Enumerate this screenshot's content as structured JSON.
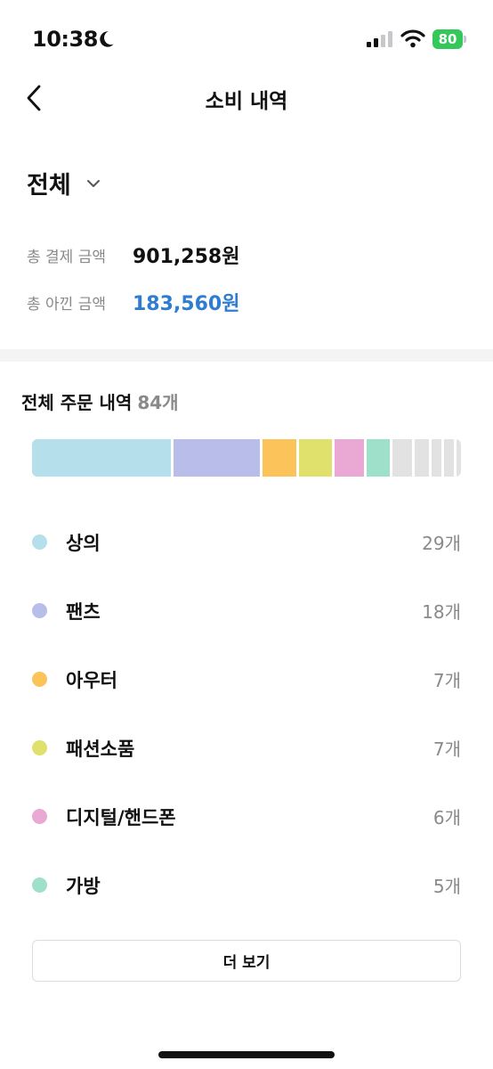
{
  "status_bar": {
    "time": "10:38",
    "battery": "80"
  },
  "header": {
    "title": "소비 내역"
  },
  "filter": {
    "label": "전체"
  },
  "summary": {
    "paid_label": "총 결제 금액",
    "paid_value": "901,258원",
    "saved_label": "총 아낀 금액",
    "saved_value": "183,560원",
    "saved_color": "#2f7dd1"
  },
  "orders": {
    "title": "전체 주문 내역",
    "count": "84개",
    "total": 84
  },
  "categories": [
    {
      "name": "상의",
      "count_label": "29개",
      "count": 29,
      "color": "#b5dfea"
    },
    {
      "name": "팬츠",
      "count_label": "18개",
      "count": 18,
      "color": "#b9bdea"
    },
    {
      "name": "아우터",
      "count_label": "7개",
      "count": 7,
      "color": "#fcc35a"
    },
    {
      "name": "패션소품",
      "count_label": "7개",
      "count": 7,
      "color": "#dfe16c"
    },
    {
      "name": "디지털/핸드폰",
      "count_label": "6개",
      "count": 6,
      "color": "#eaa9d4"
    },
    {
      "name": "가방",
      "count_label": "5개",
      "count": 5,
      "color": "#9ee0c9"
    }
  ],
  "other_segments": [
    4,
    3,
    2,
    2,
    1
  ],
  "other_color": "#e2e2e2",
  "more_button": {
    "label": "더 보기"
  }
}
